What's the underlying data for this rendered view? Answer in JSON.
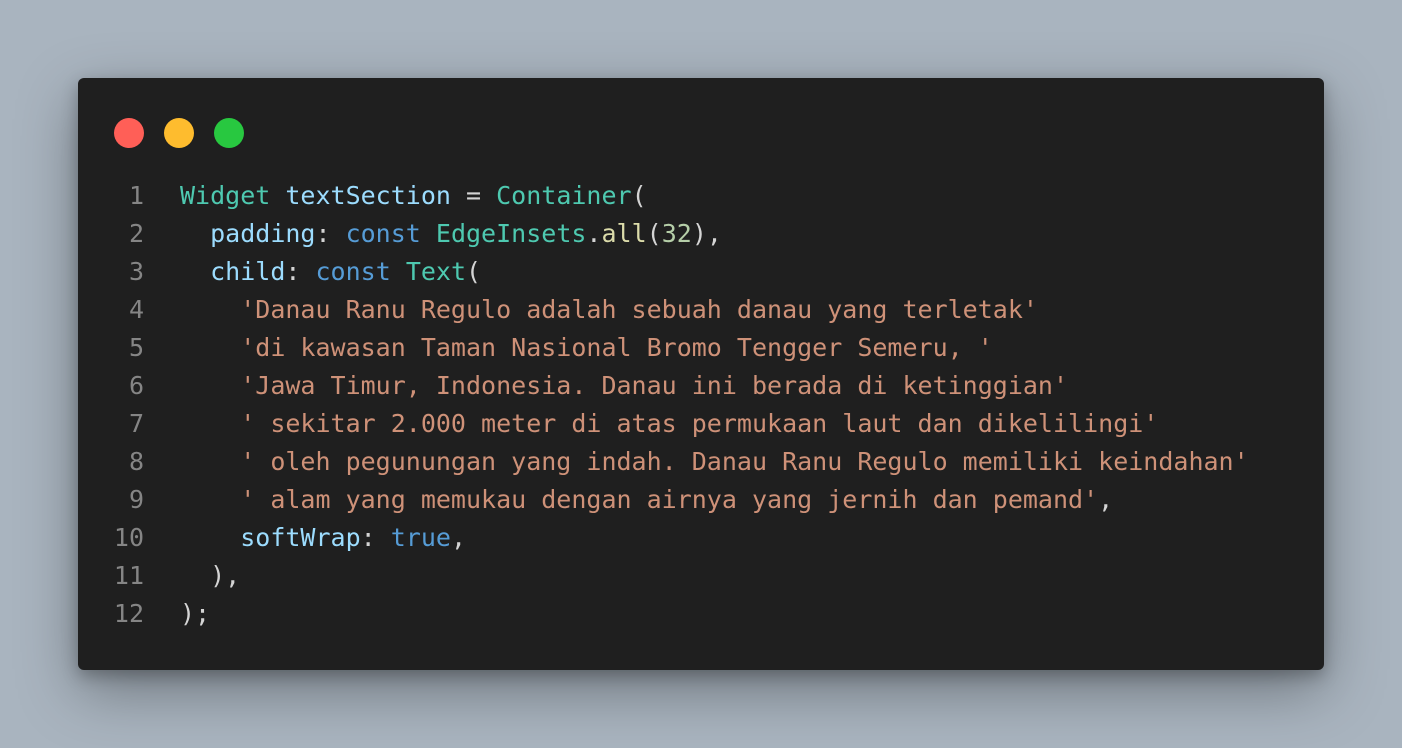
{
  "window": {
    "traffic_lights": {
      "close_color": "#ff5f57",
      "minimize_color": "#febc2e",
      "maximize_color": "#28c840"
    }
  },
  "editor": {
    "colors": {
      "default": "#d4d4d4",
      "type": "#4ec9b0",
      "variable": "#9cdcfe",
      "keyword": "#569cd6",
      "function": "#dcdcaa",
      "number": "#b5cea8",
      "string": "#ce9178",
      "line_number": "#858585"
    },
    "lines": [
      {
        "number": "1",
        "tokens": [
          {
            "text": "Widget",
            "kind": "type"
          },
          {
            "text": " ",
            "kind": "default"
          },
          {
            "text": "textSection",
            "kind": "variable"
          },
          {
            "text": " = ",
            "kind": "default"
          },
          {
            "text": "Container",
            "kind": "type"
          },
          {
            "text": "(",
            "kind": "default"
          }
        ]
      },
      {
        "number": "2",
        "tokens": [
          {
            "text": "  ",
            "kind": "default"
          },
          {
            "text": "padding",
            "kind": "variable"
          },
          {
            "text": ": ",
            "kind": "default"
          },
          {
            "text": "const",
            "kind": "keyword"
          },
          {
            "text": " ",
            "kind": "default"
          },
          {
            "text": "EdgeInsets",
            "kind": "type"
          },
          {
            "text": ".",
            "kind": "default"
          },
          {
            "text": "all",
            "kind": "function"
          },
          {
            "text": "(",
            "kind": "default"
          },
          {
            "text": "32",
            "kind": "number"
          },
          {
            "text": "),",
            "kind": "default"
          }
        ]
      },
      {
        "number": "3",
        "tokens": [
          {
            "text": "  ",
            "kind": "default"
          },
          {
            "text": "child",
            "kind": "variable"
          },
          {
            "text": ": ",
            "kind": "default"
          },
          {
            "text": "const",
            "kind": "keyword"
          },
          {
            "text": " ",
            "kind": "default"
          },
          {
            "text": "Text",
            "kind": "type"
          },
          {
            "text": "(",
            "kind": "default"
          }
        ]
      },
      {
        "number": "4",
        "tokens": [
          {
            "text": "    ",
            "kind": "default"
          },
          {
            "text": "'Danau Ranu Regulo adalah sebuah danau yang terletak'",
            "kind": "string"
          }
        ]
      },
      {
        "number": "5",
        "tokens": [
          {
            "text": "    ",
            "kind": "default"
          },
          {
            "text": "'di kawasan Taman Nasional Bromo Tengger Semeru, '",
            "kind": "string"
          }
        ]
      },
      {
        "number": "6",
        "tokens": [
          {
            "text": "    ",
            "kind": "default"
          },
          {
            "text": "'Jawa Timur, Indonesia. Danau ini berada di ketinggian'",
            "kind": "string"
          }
        ]
      },
      {
        "number": "7",
        "tokens": [
          {
            "text": "    ",
            "kind": "default"
          },
          {
            "text": "' sekitar 2.000 meter di atas permukaan laut dan dikelilingi'",
            "kind": "string"
          }
        ]
      },
      {
        "number": "8",
        "tokens": [
          {
            "text": "    ",
            "kind": "default"
          },
          {
            "text": "' oleh pegunungan yang indah. Danau Ranu Regulo memiliki keindahan'",
            "kind": "string"
          }
        ]
      },
      {
        "number": "9",
        "tokens": [
          {
            "text": "    ",
            "kind": "default"
          },
          {
            "text": "' alam yang memukau dengan airnya yang jernih dan pemand'",
            "kind": "string"
          },
          {
            "text": ",",
            "kind": "default"
          }
        ]
      },
      {
        "number": "10",
        "tokens": [
          {
            "text": "    ",
            "kind": "default"
          },
          {
            "text": "softWrap",
            "kind": "variable"
          },
          {
            "text": ": ",
            "kind": "default"
          },
          {
            "text": "true",
            "kind": "keyword"
          },
          {
            "text": ",",
            "kind": "default"
          }
        ]
      },
      {
        "number": "11",
        "tokens": [
          {
            "text": "  ),",
            "kind": "default"
          }
        ]
      },
      {
        "number": "12",
        "tokens": [
          {
            "text": ");",
            "kind": "default"
          }
        ]
      }
    ]
  }
}
